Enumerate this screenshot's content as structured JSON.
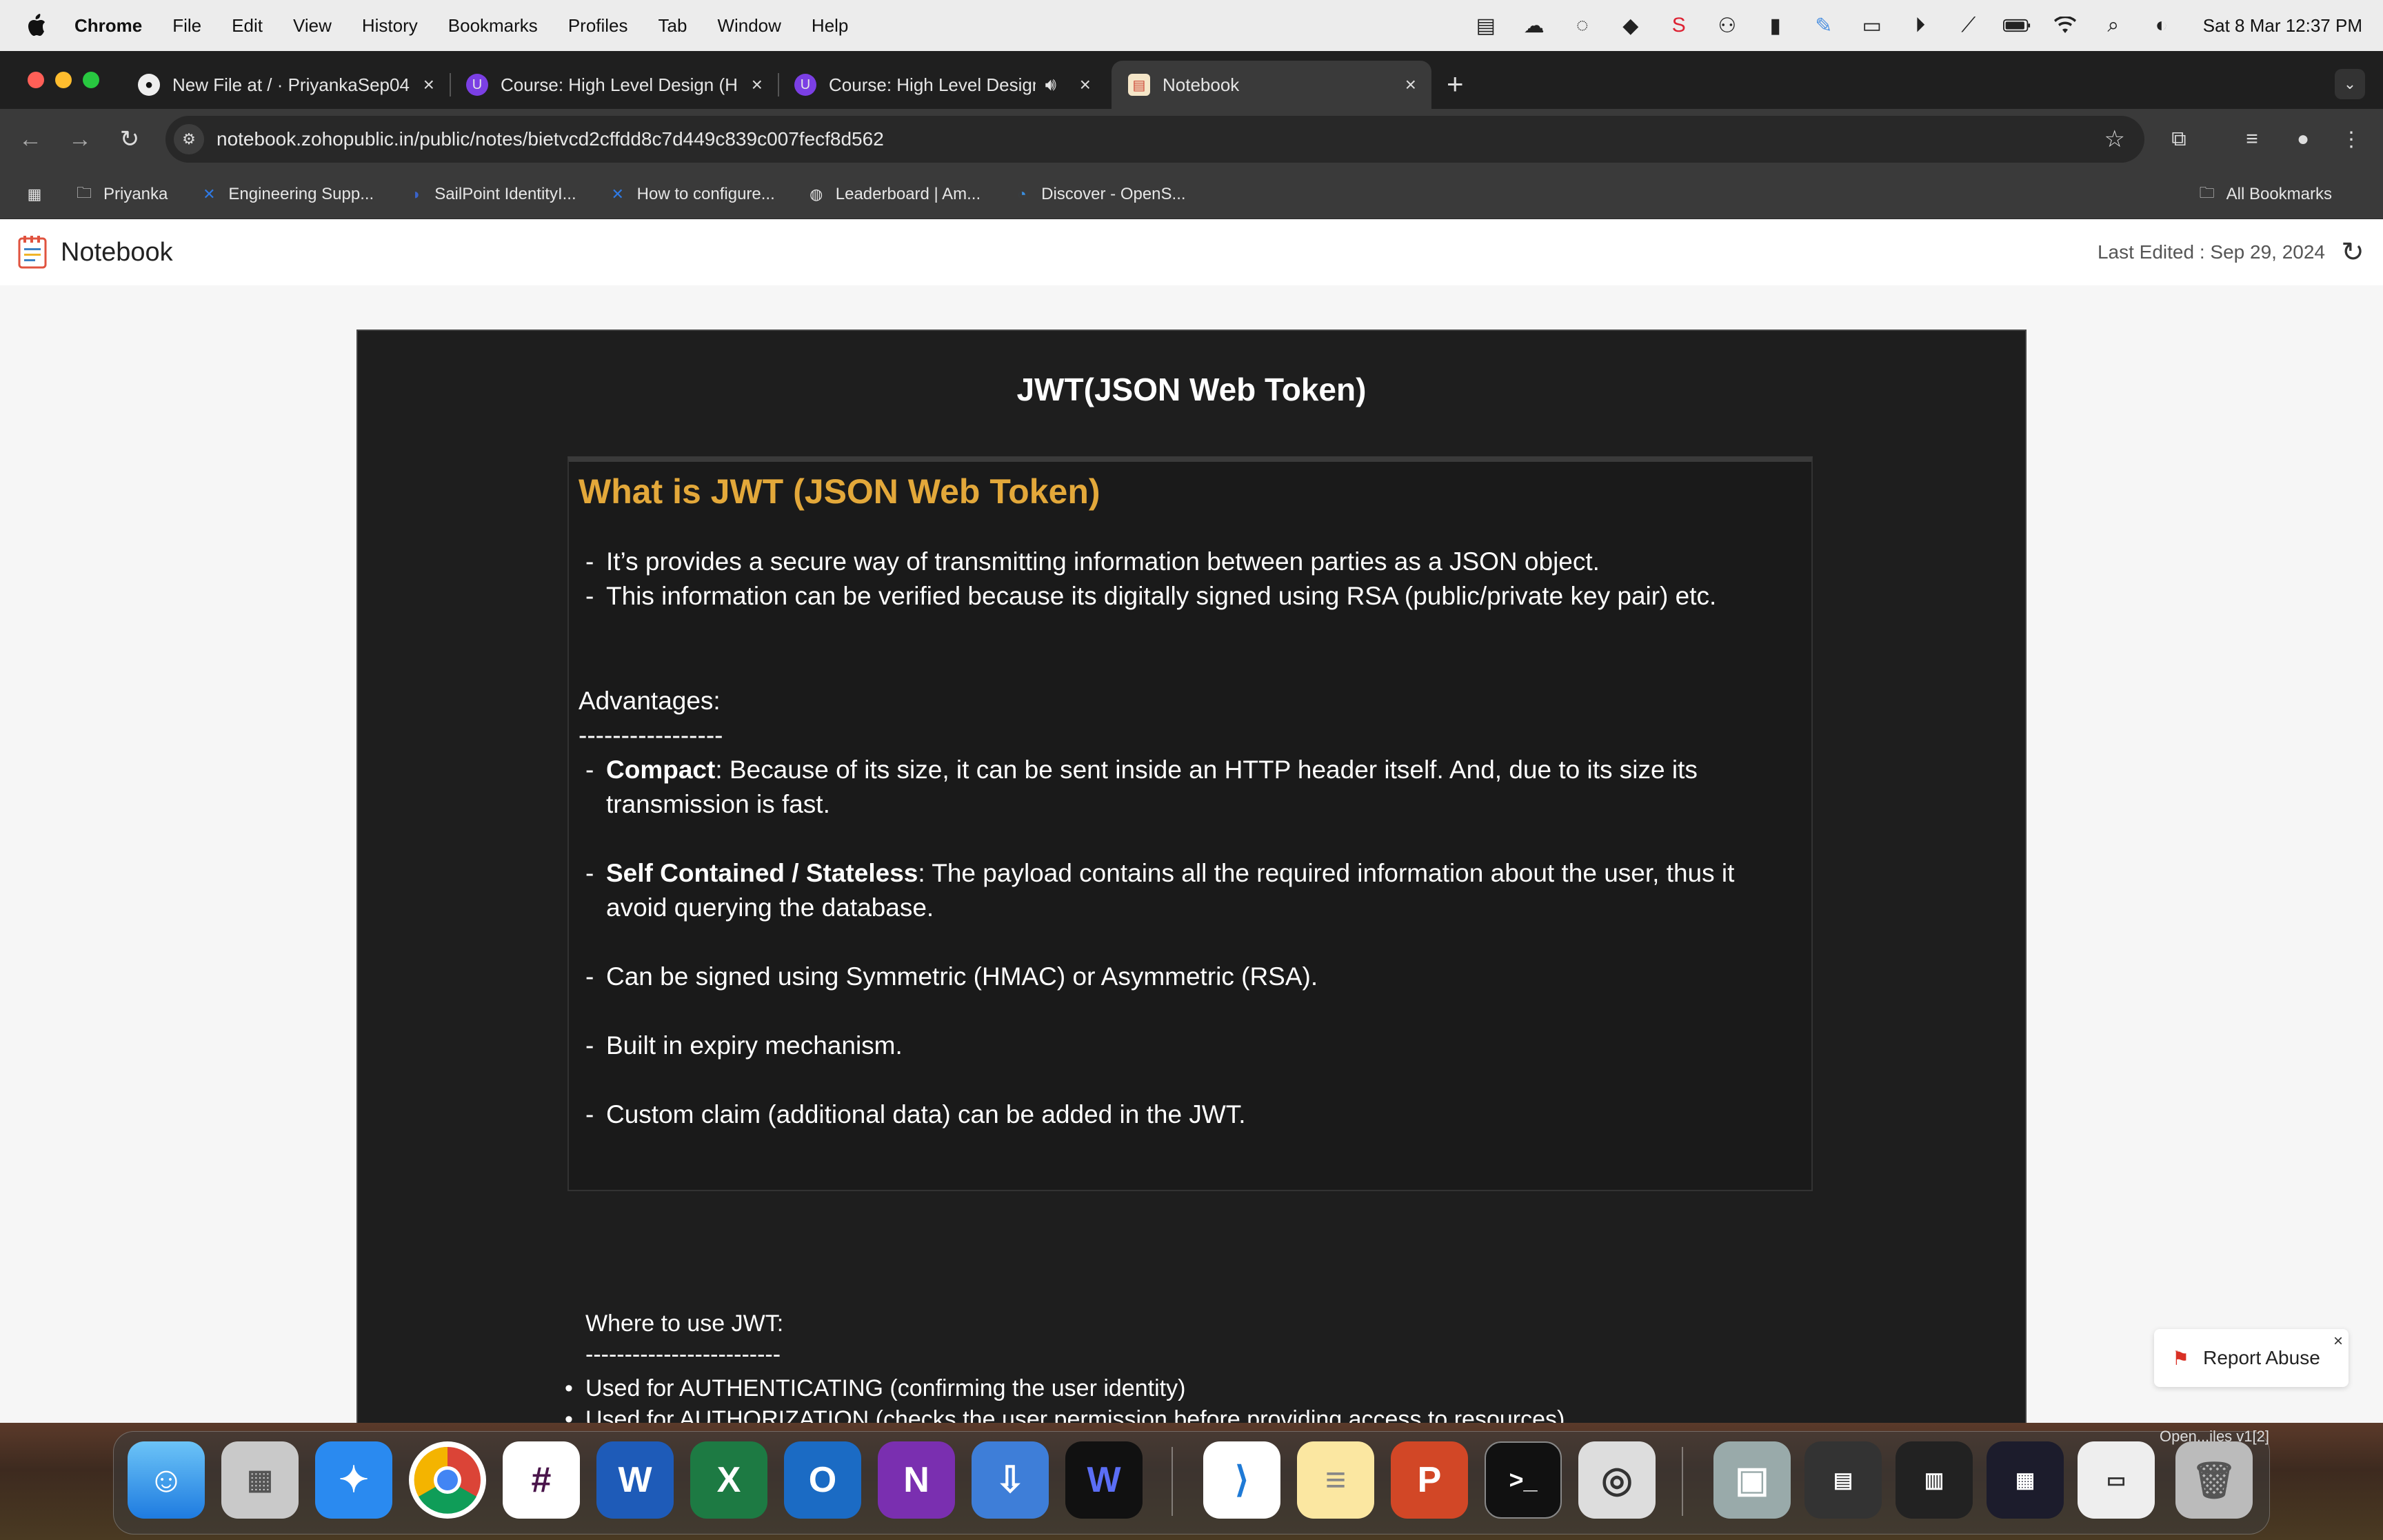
{
  "menubar": {
    "items": [
      "Chrome",
      "File",
      "Edit",
      "View",
      "History",
      "Bookmarks",
      "Profiles",
      "Tab",
      "Window",
      "Help"
    ],
    "clock": "Sat 8 Mar  12:37 PM"
  },
  "tabs": [
    {
      "title": "New File at / · PriyankaSep04",
      "icon": "github-icon"
    },
    {
      "title": "Course: High Level Design (H",
      "icon": "course-icon"
    },
    {
      "title": "Course: High Level Design",
      "icon": "course-icon"
    },
    {
      "title": "Notebook",
      "icon": "notebook-icon"
    }
  ],
  "address": {
    "url": "notebook.zohopublic.in/public/notes/bietvcd2cffdd8c7d449c839c007fecf8d562"
  },
  "bookmarks": {
    "items": [
      "Priyanka",
      "Engineering Supp...",
      "SailPoint IdentityI...",
      "How to configure...",
      "Leaderboard | Am...",
      "Discover - OpenS..."
    ],
    "all": "All Bookmarks"
  },
  "notebook": {
    "app_title": "Notebook",
    "last_edited": "Last Edited : Sep 29, 2024"
  },
  "note": {
    "title": "JWT(JSON Web Token)",
    "card": {
      "heading": "What is JWT (JSON Web Token)",
      "intro": [
        "It’s provides a secure way of transmitting information between parties as a JSON object.",
        "This information can be verified because its digitally signed using RSA (public/private key pair) etc."
      ],
      "advantages_label": "Advantages:",
      "rule": "-----------------",
      "adv1_bold": "Compact",
      "adv1_rest": ": Because of its size, it can be sent inside an HTTP header itself. And, due to its size its transmission is fast.",
      "adv2_bold": "Self Contained / Stateless",
      "adv2_rest": ": The payload contains all the required information about the user, thus it avoid querying the database.",
      "adv3": "Can be signed using Symmetric (HMAC) or Asymmetric (RSA).",
      "adv4": "Built in expiry mechanism.",
      "adv5": "Custom claim (additional data) can be added in the JWT."
    },
    "where": {
      "label": "Where to use JWT:",
      "rule": "-------------------------",
      "bullets": [
        "Used for AUTHENTICATING (confirming the user identity)",
        "Used for AUTHORIZATION (checks the user permission before providing access to resources)"
      ]
    }
  },
  "report": {
    "label": "Report Abuse"
  },
  "dock": {
    "label": "Open...iles v1[2]"
  }
}
